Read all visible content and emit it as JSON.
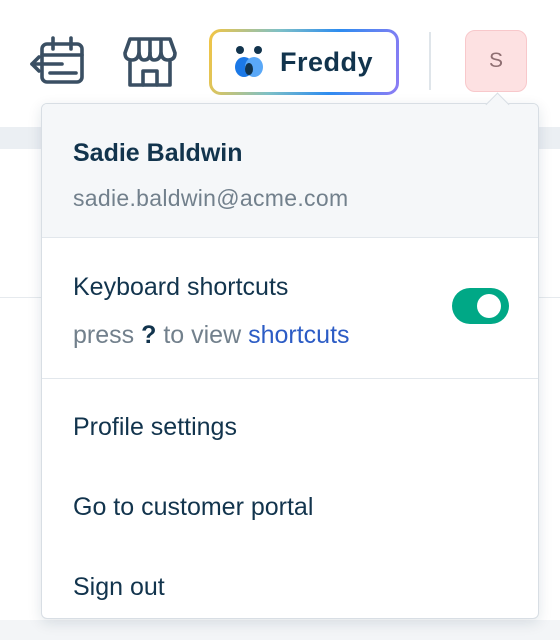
{
  "topbar": {
    "icons": {
      "calendar": "calendar-back-icon",
      "store": "store-icon",
      "freddy": "freddy-logo-icon"
    },
    "freddy_label": "Freddy",
    "avatar_initial": "S"
  },
  "user": {
    "name": "Sadie Baldwin",
    "email": "sadie.baldwin@acme.com"
  },
  "shortcuts": {
    "title": "Keyboard shortcuts",
    "hint_prefix": "press",
    "hint_key": "?",
    "hint_middle": "to view",
    "hint_link": "shortcuts",
    "enabled": true
  },
  "menu": {
    "items": [
      {
        "label": "Profile settings"
      },
      {
        "label": "Go to customer portal"
      },
      {
        "label": "Sign out"
      }
    ]
  },
  "colors": {
    "text_primary": "#12344d",
    "text_secondary": "#72808c",
    "link": "#2c5cc5",
    "toggle_on": "#00a886",
    "avatar_bg": "#fde1e2"
  }
}
